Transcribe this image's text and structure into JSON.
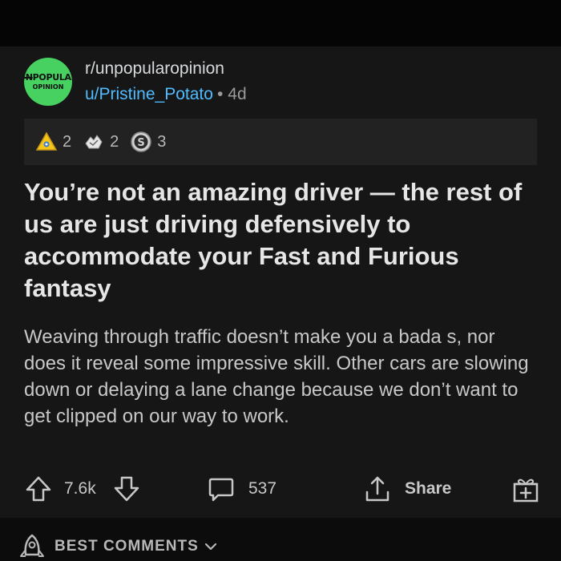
{
  "post": {
    "subreddit": "r/unpopularopinion",
    "avatar_line1_struck": "UN",
    "avatar_line1_rest": "POPULAR",
    "avatar_line2": "OPINION",
    "author": "u/Pristine_Potato",
    "separator": "•",
    "age": "4d",
    "awards": [
      {
        "icon": "helpful-award-icon",
        "count": "2"
      },
      {
        "icon": "wholesome-award-icon",
        "count": "2"
      },
      {
        "icon": "silver-award-icon",
        "count": "3"
      }
    ],
    "title": "You’re not an amazing driver — the rest of us are just driving defensively to accommodate your Fast and Furious fantasy",
    "body": "Weaving through traffic doesn’t make you a bada  s, nor does it reveal some impressive skill. Other cars are slowing down or delaying a lane change because we don’t want to get clipped on our way to work."
  },
  "actions": {
    "score": "7.6k",
    "comments": "537",
    "share_label": "Share"
  },
  "sort": {
    "label": "BEST COMMENTS"
  },
  "colors": {
    "background": "#0b0b0b",
    "card": "#161616",
    "award_bar": "#222222",
    "link": "#4fbcff",
    "avatar_green": "#46d160"
  }
}
